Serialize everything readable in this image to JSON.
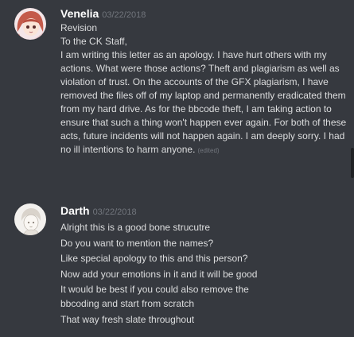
{
  "messages": [
    {
      "author": "Venelia",
      "timestamp": "03/22/2018",
      "avatar_icon": "anime-girl-avatar",
      "lines": [
        "Revision",
        "To the CK Staff,",
        "I am writing this letter as an apology. I have hurt others with my actions. What were those actions? Theft and plagiarism as well as violation of trust. On the accounts of the GFX plagiarism, I have removed the files off of my laptop and permanently eradicated them from my hard drive. As for the bbcode theft, I am taking action to ensure that such a thing won't happen ever again. For both of these acts, future incidents will not happen again. I am deeply sorry. I had no ill intentions to harm anyone."
      ],
      "edited_label": "(edited)"
    },
    {
      "author": "Darth",
      "timestamp": "03/22/2018",
      "avatar_icon": "sketch-character-avatar",
      "lines": [
        "Alright this is a good bone strucutre",
        "Do you want to mention the names?",
        "Like special apology to this and this person?",
        "Now add your emotions in it and it will be good",
        "It would be best if you could also remove the bbcoding and start from scratch",
        "That way fresh slate throughout"
      ]
    }
  ],
  "colors": {
    "background": "#36393f",
    "username": "#ffffff",
    "text": "#dcddde",
    "muted": "#72767d"
  }
}
